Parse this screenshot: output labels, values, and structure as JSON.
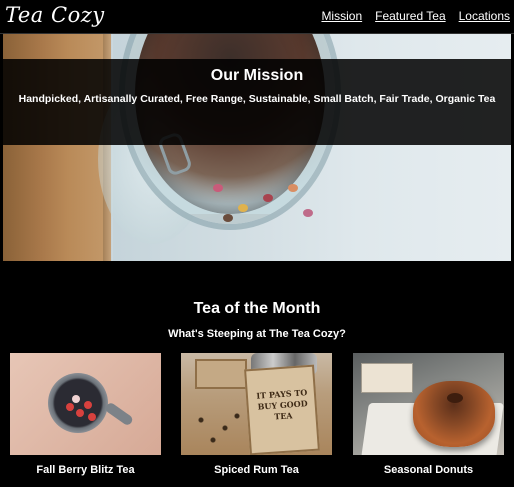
{
  "header": {
    "logo": "Tea Cozy",
    "nav": [
      {
        "label": "Mission"
      },
      {
        "label": "Featured Tea"
      },
      {
        "label": "Locations"
      }
    ]
  },
  "hero": {
    "title": "Our Mission",
    "text": "Handpicked, Artisanally Curated, Free Range, Sustainable, Small Batch, Fair Trade, Organic Tea"
  },
  "featured": {
    "title": "Tea of the Month",
    "subtitle": "What's Steeping at The Tea Cozy?",
    "items": [
      {
        "name": "Fall Berry Blitz Tea"
      },
      {
        "name": "Spiced Rum Tea"
      },
      {
        "name": "Seasonal Donuts"
      }
    ],
    "box_text": "IT PAYS TO BUY GOOD TEA"
  }
}
